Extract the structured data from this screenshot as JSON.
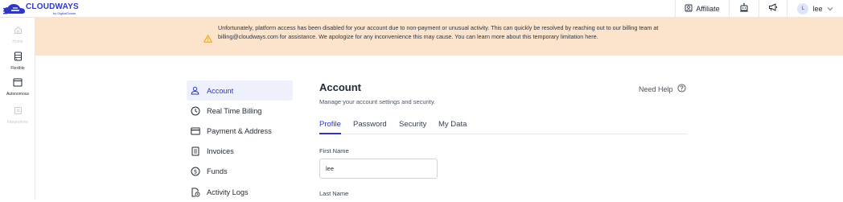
{
  "brand": {
    "name": "CLOUDWAYS",
    "sub": "by DigitalOcean",
    "color": "#2e39bf"
  },
  "topbar": {
    "affiliate_label": "Affiliate",
    "user": {
      "initial": "L",
      "name": "lee"
    }
  },
  "rail": {
    "items": [
      {
        "label": "Home",
        "icon": "home-icon",
        "state": "disabled"
      },
      {
        "label": "Flexible",
        "icon": "server-icon",
        "state": "enabled"
      },
      {
        "label": "Autonomous",
        "icon": "window-icon",
        "state": "enabled"
      },
      {
        "label": "Integrations",
        "icon": "puzzle-icon",
        "state": "disabled"
      }
    ]
  },
  "banner": {
    "text": "Unfortunately, platform access has been disabled for your account due to non-payment or unusual activity. This can quickly be resolved by reaching out to our billing team at billing@cloudways.com for assistance. We apologize for any inconvenience this may cause. You can learn more about this temporary limitation here.",
    "color": "#fbe3cc"
  },
  "settings_nav": {
    "items": [
      {
        "label": "Account",
        "icon": "user-icon",
        "active": true
      },
      {
        "label": "Real Time Billing",
        "icon": "clock-icon",
        "active": false
      },
      {
        "label": "Payment & Address",
        "icon": "credit-card-icon",
        "active": false
      },
      {
        "label": "Invoices",
        "icon": "invoice-icon",
        "active": false
      },
      {
        "label": "Funds",
        "icon": "dollar-icon",
        "active": false
      },
      {
        "label": "Activity Logs",
        "icon": "activity-log-icon",
        "active": false
      }
    ]
  },
  "main": {
    "title": "Account",
    "subtitle": "Manage your account settings and security.",
    "help_label": "Need Help",
    "tabs": [
      {
        "label": "Profile",
        "active": true
      },
      {
        "label": "Password",
        "active": false
      },
      {
        "label": "Security",
        "active": false
      },
      {
        "label": "My Data",
        "active": false
      }
    ],
    "fields": {
      "first_name": {
        "label": "First Name",
        "value": "lee"
      },
      "last_name": {
        "label": "Last Name"
      }
    }
  }
}
